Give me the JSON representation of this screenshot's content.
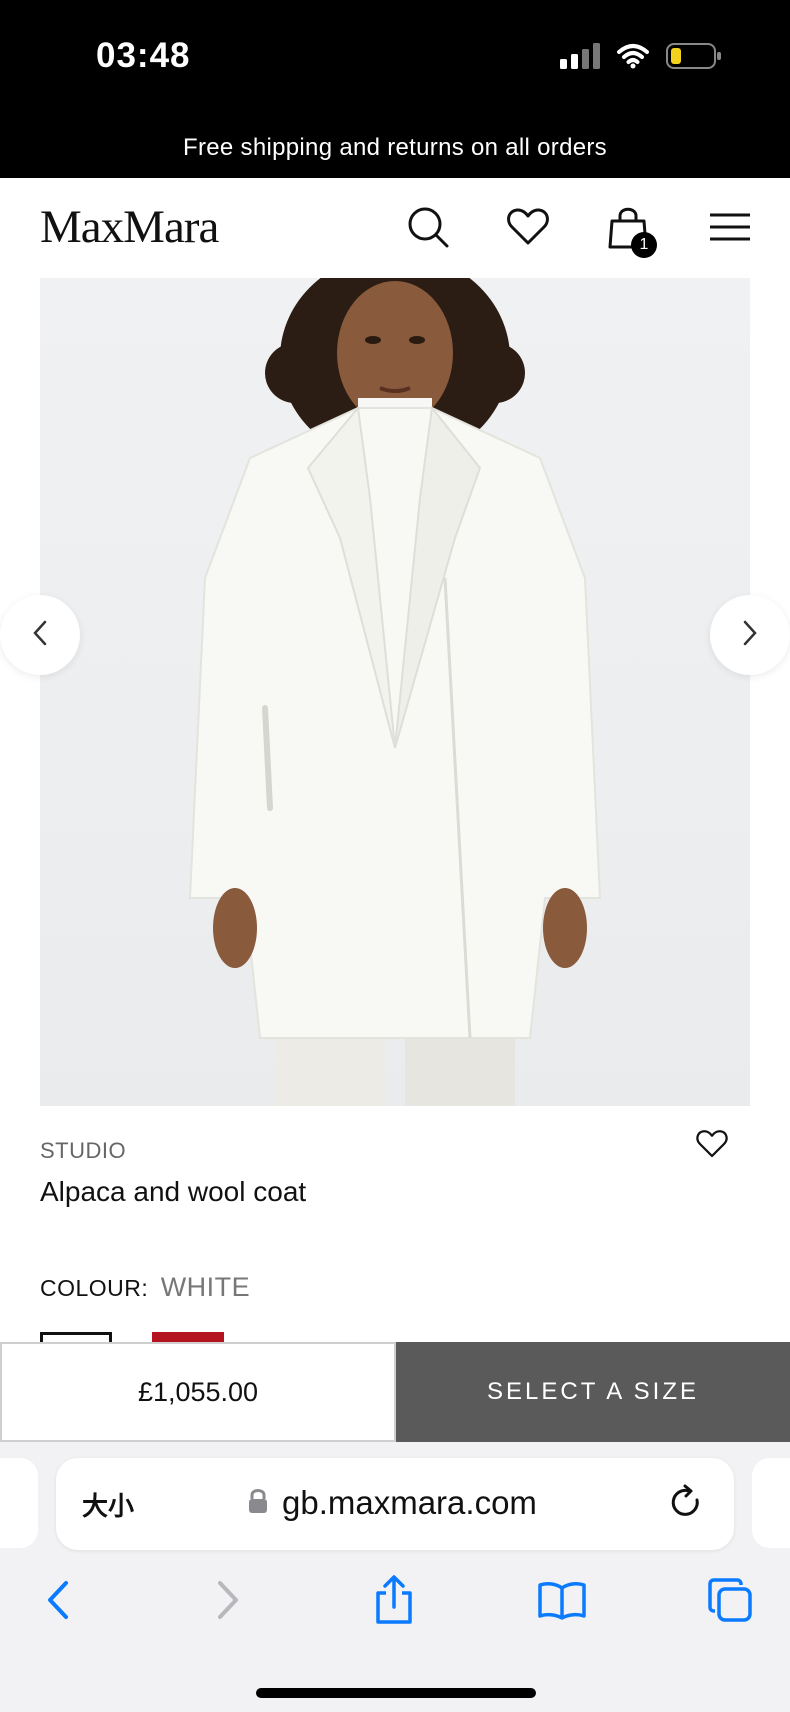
{
  "status_bar": {
    "time": "03:48"
  },
  "promo": {
    "text": "Free shipping and returns on all orders"
  },
  "header": {
    "logo": "MaxMara",
    "search_icon": "search-icon",
    "wishlist_icon": "heart-icon",
    "bag_icon": "shopping-bag-icon",
    "bag_count": "1",
    "menu_icon": "hamburger-menu-icon"
  },
  "product": {
    "brand": "STUDIO",
    "title": "Alpaca and wool coat",
    "colour_label": "COLOUR:",
    "colour_value": "WHITE",
    "swatches": [
      {
        "name": "white",
        "color": "#ffffff",
        "selected": true
      },
      {
        "name": "red",
        "color": "#b3141f",
        "selected": false
      }
    ],
    "price": "£1,055.00",
    "cta": "SELECT A SIZE"
  },
  "browser": {
    "text_size_label": "大小",
    "url": "gb.maxmara.com",
    "toolbar": [
      "back-icon",
      "forward-icon",
      "share-icon",
      "bookmarks-icon",
      "tabs-icon"
    ]
  },
  "colors": {
    "accent_blue": "#0a7aff",
    "cta_bg": "#5a5a5a"
  }
}
